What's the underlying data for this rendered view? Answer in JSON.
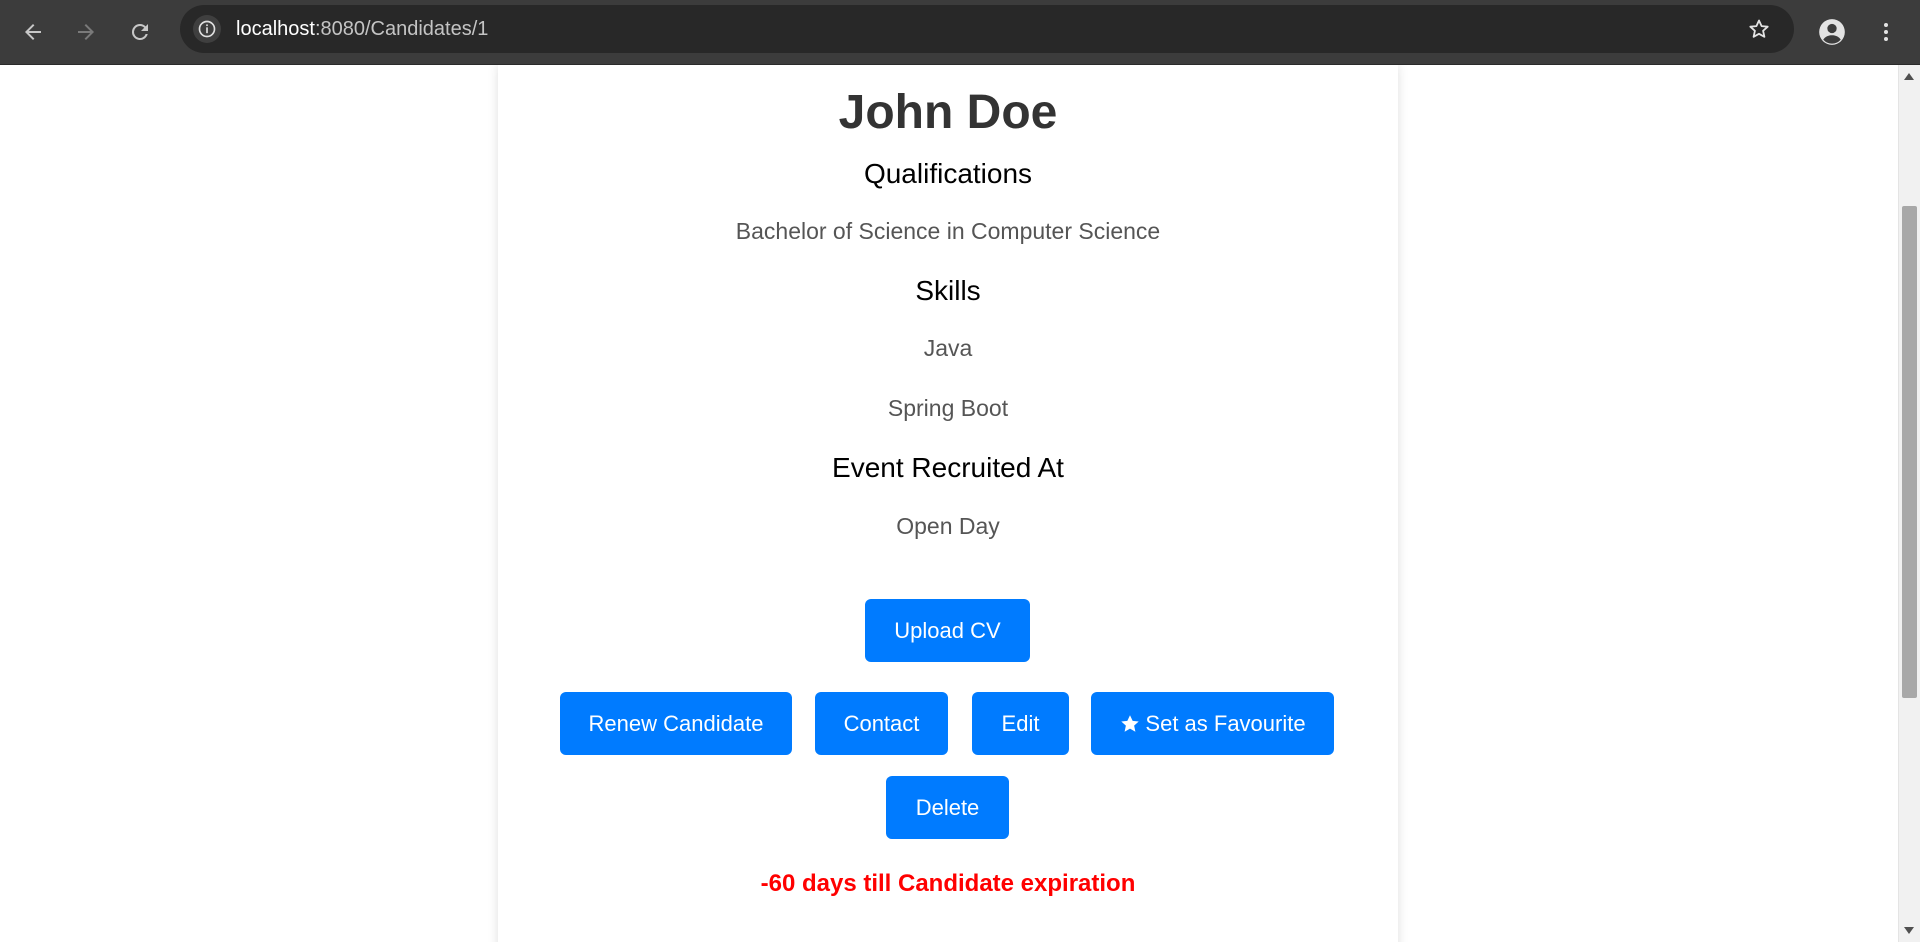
{
  "browser": {
    "url_host": "localhost",
    "url_rest": ":8080/Candidates/1",
    "icons": {
      "back": "arrow-left-icon",
      "forward": "arrow-right-icon",
      "reload": "reload-icon",
      "site_info": "info-icon",
      "bookmark": "star-outline-icon",
      "profile": "person-icon",
      "menu": "kebab-menu-icon"
    }
  },
  "candidate": {
    "name": "John Doe",
    "qualifications_heading": "Qualifications",
    "qualifications": [
      "Bachelor of Science in Computer Science"
    ],
    "skills_heading": "Skills",
    "skills": [
      "Java",
      "Spring Boot"
    ],
    "event_heading": "Event Recruited At",
    "event": "Open Day"
  },
  "actions": {
    "upload_cv": "Upload CV",
    "renew": "Renew Candidate",
    "contact": "Contact",
    "edit": "Edit",
    "favourite": "Set as Favourite",
    "favourite_icon": "star-filled-icon",
    "delete": "Delete"
  },
  "status": {
    "expiry_message": "-60 days till Candidate expiration",
    "expiry_color": "#ff0000"
  },
  "colors": {
    "button_bg": "#007bff",
    "chrome_bg": "#3c3c3c",
    "omnibox_bg": "#282828"
  }
}
